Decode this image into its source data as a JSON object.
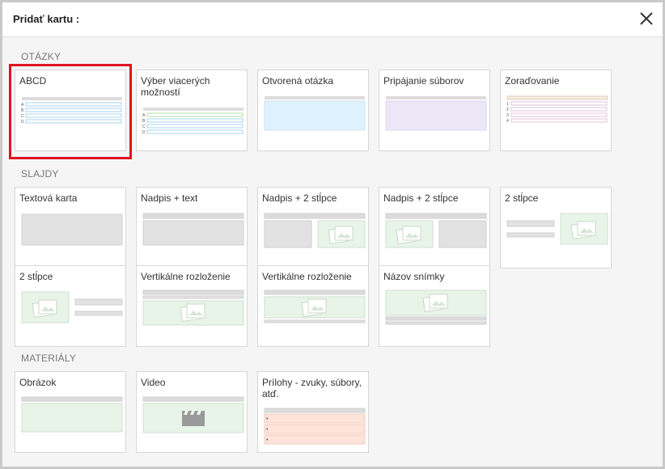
{
  "dialog": {
    "title": "Pridať kartu :"
  },
  "sections": {
    "questions": "OTÁZKY",
    "slides": "SLAJDY",
    "materials": "MATERIÁLY"
  },
  "cards": {
    "abcd": "ABCD",
    "multi": "Výber viacerých možností",
    "open": "Otvorená otázka",
    "file": "Pripájanie súborov",
    "order": "Zoraďovanie",
    "textcard": "Textová karta",
    "title_text": "Nadpis + text",
    "title_2col_a": "Nadpis + 2 stĺpce",
    "title_2col_b": "Nadpis + 2 stĺpce",
    "cols2_a": "2 stĺpce",
    "cols2_b": "2 stĺpce",
    "vertical_a": "Vertikálne rozloženie",
    "vertical_b": "Vertikálne rozloženie",
    "slide_title": "Názov snímky",
    "image": "Obrázok",
    "video": "Video",
    "attachments": "Prílohy - zvuky, súbory, atď."
  },
  "glyphs": {
    "abc": [
      "A",
      "B",
      "C",
      "D"
    ],
    "nums": [
      "1",
      "2",
      "3",
      "4"
    ],
    "bullet": "•"
  },
  "colors": {
    "selected_border": "#e0141e",
    "bar_gray": "#dddddd",
    "open_fill": "#ddf2fd",
    "file_fill": "#ece7f7",
    "image_fill": "#e8f4e8",
    "attach_fill": "#fde3d9"
  }
}
